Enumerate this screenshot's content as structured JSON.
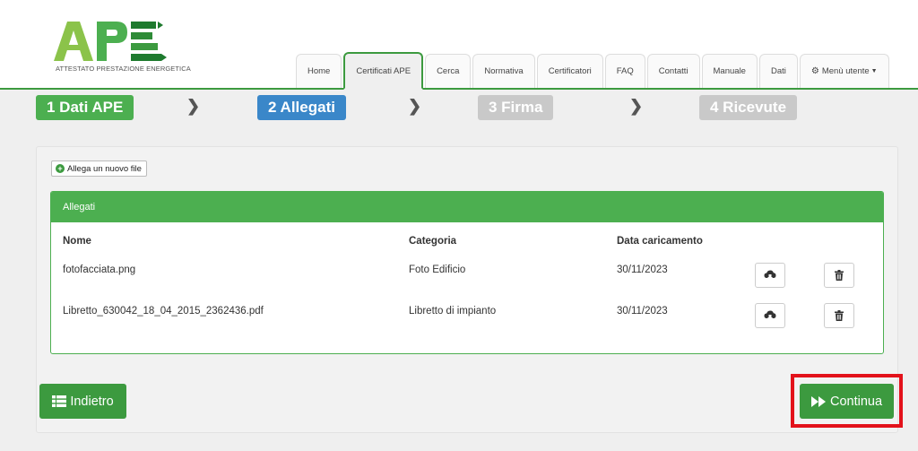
{
  "brand": {
    "logo_text": "APE",
    "subtitle": "ATTESTATO PRESTAZIONE ENERGETICA",
    "color": "#3c9a3f",
    "accent": "#8bc34a"
  },
  "nav": {
    "tabs": [
      {
        "label": "Home"
      },
      {
        "label": "Certificati APE",
        "active": true
      },
      {
        "label": "Cerca"
      },
      {
        "label": "Normativa"
      },
      {
        "label": "Certificatori"
      },
      {
        "label": "FAQ"
      },
      {
        "label": "Contatti"
      },
      {
        "label": "Manuale"
      },
      {
        "label": "Dati"
      },
      {
        "label": "Menù utente",
        "icon": "gear-icon",
        "dropdown": true
      }
    ]
  },
  "steps": [
    {
      "label": "1 Dati APE",
      "state": "done"
    },
    {
      "label": "2 Allegati",
      "state": "current"
    },
    {
      "label": "3 Firma",
      "state": "pending"
    },
    {
      "label": "4 Ricevute",
      "state": "pending"
    }
  ],
  "attachments": {
    "add_label": "Allega un nuovo file",
    "panel_title": "Allegati",
    "columns": {
      "name": "Nome",
      "category": "Categoria",
      "date": "Data caricamento"
    },
    "rows": [
      {
        "name": "fotofacciata.png",
        "category": "Foto Edificio",
        "date": "30/11/2023"
      },
      {
        "name": "Libretto_630042_18_04_2015_2362436.pdf",
        "category": "Libretto di impianto",
        "date": "30/11/2023"
      }
    ]
  },
  "actions": {
    "back_label": "Indietro",
    "next_label": "Continua"
  },
  "colors": {
    "primary_green": "#4caf50",
    "button_green": "#3c9a3f",
    "step_blue": "#3a87c9",
    "step_grey": "#c9c9c9",
    "highlight_red": "#e3121b"
  }
}
